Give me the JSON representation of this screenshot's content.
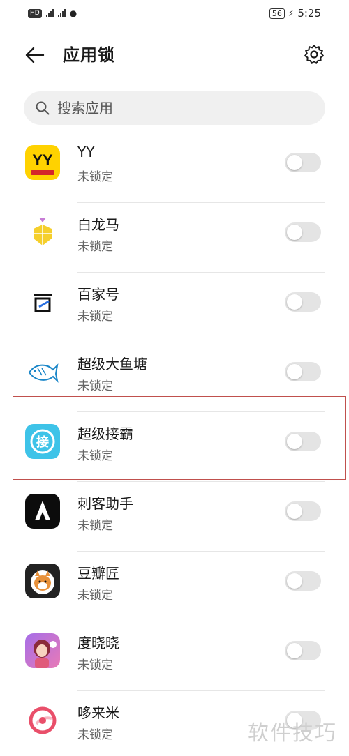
{
  "statusbar": {
    "left": "HD 4G 4G",
    "battery": "56",
    "time": "5:25"
  },
  "header": {
    "title": "应用锁"
  },
  "search": {
    "placeholder": "搜索应用"
  },
  "apps": [
    {
      "name": "YY",
      "status": "未锁定",
      "icon": "yy-app-icon",
      "locked": false
    },
    {
      "name": "白龙马",
      "status": "未锁定",
      "icon": "bailongma-app-icon",
      "locked": false
    },
    {
      "name": "百家号",
      "status": "未锁定",
      "icon": "baijiahao-app-icon",
      "locked": false
    },
    {
      "name": "超级大鱼塘",
      "status": "未锁定",
      "icon": "fish-pond-app-icon",
      "locked": false
    },
    {
      "name": "超级接霸",
      "status": "未锁定",
      "icon": "jieba-app-icon",
      "locked": false
    },
    {
      "name": "刺客助手",
      "status": "未锁定",
      "icon": "assassin-app-icon",
      "locked": false
    },
    {
      "name": "豆瓣匠",
      "status": "未锁定",
      "icon": "doubanjiang-app-icon",
      "locked": false
    },
    {
      "name": "度晓晓",
      "status": "未锁定",
      "icon": "duxiaoxiao-app-icon",
      "locked": false
    },
    {
      "name": "哆来米",
      "status": "未锁定",
      "icon": "duolaimi-app-icon",
      "locked": false
    }
  ],
  "watermark": "软件技巧",
  "colors": {
    "toggle_off": "#e4e4e4",
    "highlight": "#c0504d",
    "search_bg": "#f0f0f0"
  }
}
